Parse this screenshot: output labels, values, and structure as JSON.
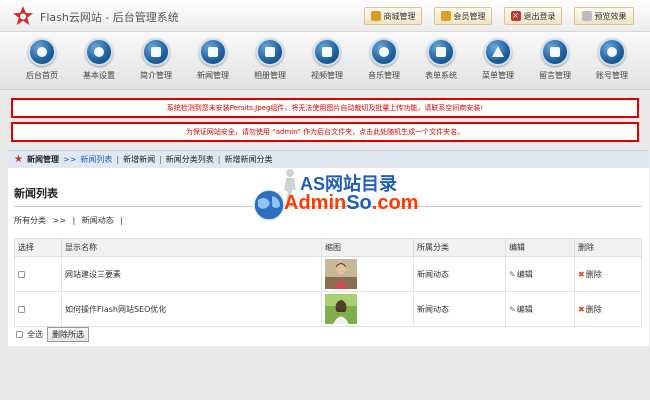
{
  "header": {
    "brand": "Flash云网站 - 后台管理系统",
    "buttons": [
      {
        "label": "商城管理",
        "icon": "shop-icon"
      },
      {
        "label": "会员管理",
        "icon": "member-icon"
      },
      {
        "label": "退出登录",
        "icon": "logout-icon"
      },
      {
        "label": "预览效果",
        "icon": "preview-icon"
      }
    ]
  },
  "nav": {
    "items": [
      {
        "label": "后台首页",
        "icon": "home-globe-icon"
      },
      {
        "label": "基本设置",
        "icon": "heart-icon"
      },
      {
        "label": "简介管理",
        "icon": "document-icon"
      },
      {
        "label": "新闻管理",
        "icon": "news-icon"
      },
      {
        "label": "相册管理",
        "icon": "album-icon"
      },
      {
        "label": "视频管理",
        "icon": "video-icon"
      },
      {
        "label": "音乐管理",
        "icon": "music-icon"
      },
      {
        "label": "表单系统",
        "icon": "form-icon"
      },
      {
        "label": "菜单管理",
        "icon": "star-icon"
      },
      {
        "label": "留言管理",
        "icon": "message-icon"
      },
      {
        "label": "账号管理",
        "icon": "key-icon"
      }
    ]
  },
  "alerts": {
    "persits": "系统检测到您未安装Persits.Jpeg组件，将无法使用图片自动裁切及批量上传功能，请联系空间商安装!",
    "security": "为保证网站安全，请勿使用 “admin” 作为后台文件夹，点击此处随机生成一个文件夹名。"
  },
  "breadcrumb": {
    "section": "新闻管理",
    "arrow": ">>",
    "current": "新闻列表",
    "links": [
      "新增新闻",
      "新闻分类列表",
      "新增新闻分类"
    ],
    "separator": "|"
  },
  "main": {
    "title": "新闻列表",
    "categories": {
      "all": "所有分类",
      "arrow": ">>",
      "sep": "|",
      "item": "新闻动态"
    },
    "table": {
      "headers": [
        "选择",
        "显示名称",
        "缩图",
        "所属分类",
        "编辑",
        "删除"
      ],
      "rows": [
        {
          "name": "网站建设三要素",
          "category": "新闻动态",
          "edit": "编辑",
          "delete": "删除"
        },
        {
          "name": "如何操作Flash网站SEO优化",
          "category": "新闻动态",
          "edit": "编辑",
          "delete": "删除"
        }
      ]
    },
    "select_all": "全选",
    "delete_selected": "删除所选"
  },
  "watermark": {
    "line1": "AS网站目录",
    "line2_a": "Admin",
    "line2_b": "So",
    "line2_c": ".com"
  },
  "colors": {
    "alert": "#e00000",
    "link": "#1b63b5",
    "nav_icon": "#1d5f9c",
    "crumb_bg": "#e1e8f1"
  }
}
